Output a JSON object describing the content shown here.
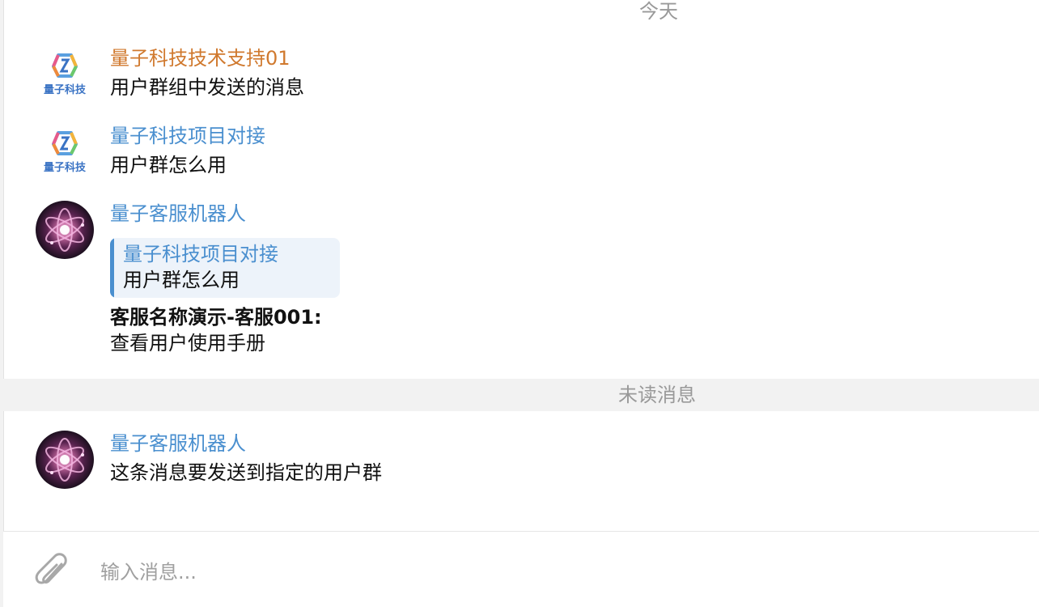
{
  "chat": {
    "date_separator": "今天",
    "unread_separator": "未读消息",
    "messages": [
      {
        "sender": "量子科技技术支持01",
        "sender_color": "#d0792e",
        "avatar": "company-logo",
        "avatar_caption": "量子科技",
        "text": "用户群组中发送的消息"
      },
      {
        "sender": "量子科技项目对接",
        "sender_color": "#4a8fcf",
        "avatar": "company-logo",
        "avatar_caption": "量子科技",
        "text": "用户群怎么用"
      },
      {
        "sender": "量子客服机器人",
        "sender_color": "#4a8fcf",
        "avatar": "atom-bot",
        "quote": {
          "sender": "量子科技项目对接",
          "text": "用户群怎么用"
        },
        "agent_line": "客服名称演示-客服001:",
        "text": "查看用户使用手册"
      },
      {
        "sender": "量子客服机器人",
        "sender_color": "#4a8fcf",
        "avatar": "atom-bot",
        "text": "这条消息要发送到指定的用户群"
      }
    ]
  },
  "composer": {
    "placeholder": "输入消息...",
    "value": "",
    "attach_icon": "paperclip-icon"
  },
  "colors": {
    "link_blue": "#4a8fcf",
    "orange_sender": "#d0792e",
    "separator_bg": "#f2f2f2",
    "quote_bg": "#edf3fa"
  }
}
